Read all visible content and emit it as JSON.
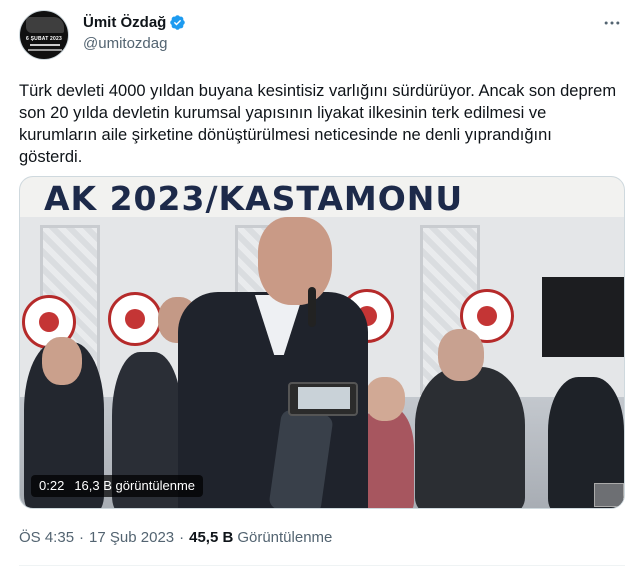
{
  "author": {
    "display_name": "Ümit Özdağ",
    "handle": "@umitozdag",
    "avatar_text": "6 ŞUBAT 2023"
  },
  "tweet": {
    "text": "Türk devleti 4000 yıldan buyana kesintisiz varlığını sürdürüyor. Ancak son deprem son 20 yılda devletin kurumsal yapısının liyakat ilkesinin terk edilmesi ve kurumların aile şirketine dönüştürülmesi neticesinde ne denli yıprandığını gösterdi."
  },
  "media": {
    "banner_text": "AK 2023/KASTAMONU",
    "duration": "0:22",
    "video_views": "16,3 B görüntülenme"
  },
  "meta": {
    "time": "ÖS 4:35",
    "separator": "·",
    "date": "17 Şub 2023",
    "views_count": "45,5 B",
    "views_label": "Görüntülenme"
  },
  "colors": {
    "verified": "#1d9bf0",
    "secondary_text": "#536471",
    "primary_text": "#0f1419"
  },
  "icons": {
    "verified": "verified-badge-icon",
    "more": "more-horizontal-icon"
  }
}
